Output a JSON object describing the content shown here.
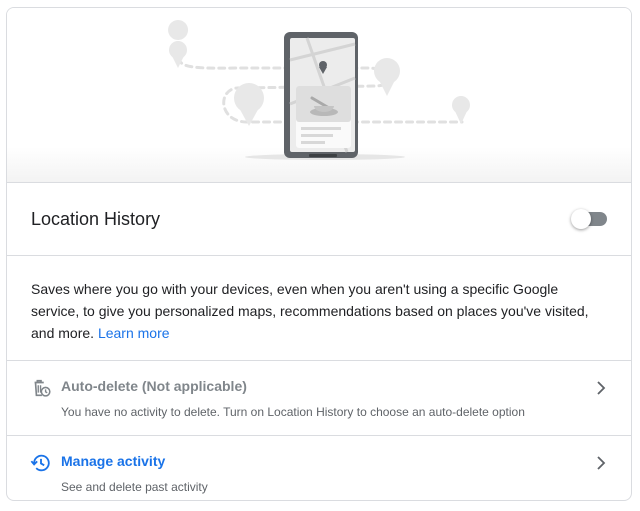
{
  "location_history": {
    "title": "Location History",
    "enabled": false,
    "description": "Saves where you go with your devices, even when you aren't using a specific Google service, to give you personalized maps, recommendations based on places you've visited, and more.",
    "learn_more": "Learn more"
  },
  "options": [
    {
      "title": "Auto-delete (Not applicable)",
      "subtitle": "You have no activity to delete. Turn on Location History to choose an auto-delete option",
      "icon": "trash-clock-icon"
    },
    {
      "title": "Manage activity",
      "subtitle": "See and delete past activity",
      "icon": "history-icon"
    }
  ],
  "colors": {
    "link": "#1a73e8",
    "text": "#202124",
    "muted": "#5f6368",
    "toggle_track_off": "#80868b"
  }
}
